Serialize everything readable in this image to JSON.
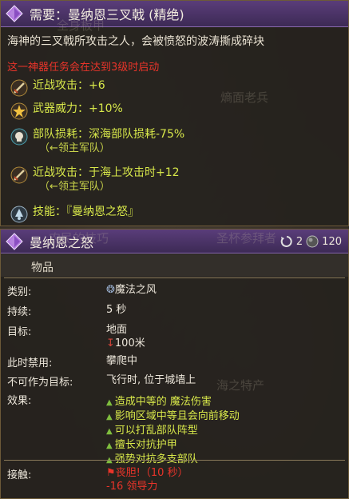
{
  "card": {
    "title": "需要：曼纳恩三叉戟 (精绝)",
    "description": "海神的三叉戟所攻击之人，会被愤怒的波涛撕成碎块",
    "notice": "这一神器任务会在达到3级时启动",
    "stats": [
      {
        "icon": "melee-attack-icon",
        "text": "近战攻击：+6"
      },
      {
        "icon": "weapon-power-icon",
        "text": "武器威力：+10%"
      },
      {
        "icon": "unit-losses-icon",
        "text": "部队损耗：深海部队损耗-75%",
        "sub": "（←领主军队）"
      },
      {
        "icon": "melee-attack-icon",
        "text": "近战攻击：于海上攻击时+12",
        "sub": "（←领主军队）"
      },
      {
        "icon": "skill-icon",
        "text": "技能：『曼纳恩之怒』"
      }
    ],
    "sub_mark": "↖"
  },
  "ability": {
    "title": "曼纳恩之怒",
    "cooldown": "2",
    "cost": "120",
    "category": "物品",
    "rows": [
      {
        "label": "类别:",
        "value": [
          "魔法之风"
        ]
      },
      {
        "label": "持续:",
        "value": [
          "5 秒"
        ]
      },
      {
        "label": "目标:",
        "value": [
          "地面",
          "100米"
        ]
      },
      {
        "label": "此时禁用:",
        "value": [
          "攀爬中"
        ]
      },
      {
        "label": "不可作为目标:",
        "value": [
          "飞行时, 位于城墙上"
        ]
      }
    ],
    "effects_label": "效果:",
    "effects": [
      "造成中等的 魔法伤害",
      "影响区域中等且会向前移动",
      "可以打乱部队阵型",
      "擅长对抗护甲",
      "强势对抗多支部队"
    ],
    "contact_label": "接触:",
    "contact": [
      "丧胆!（10 秒）",
      "-16 领导力"
    ]
  },
  "background_text": [
    "全身板甲",
    "熵面老兵",
    "农民的技巧",
    "圣杯参拜者",
    "海之特产"
  ],
  "colors": {
    "accent_purple": "#5a3d7a",
    "stat_yellow": "#d8e84a",
    "warning_red": "#e8342a"
  }
}
